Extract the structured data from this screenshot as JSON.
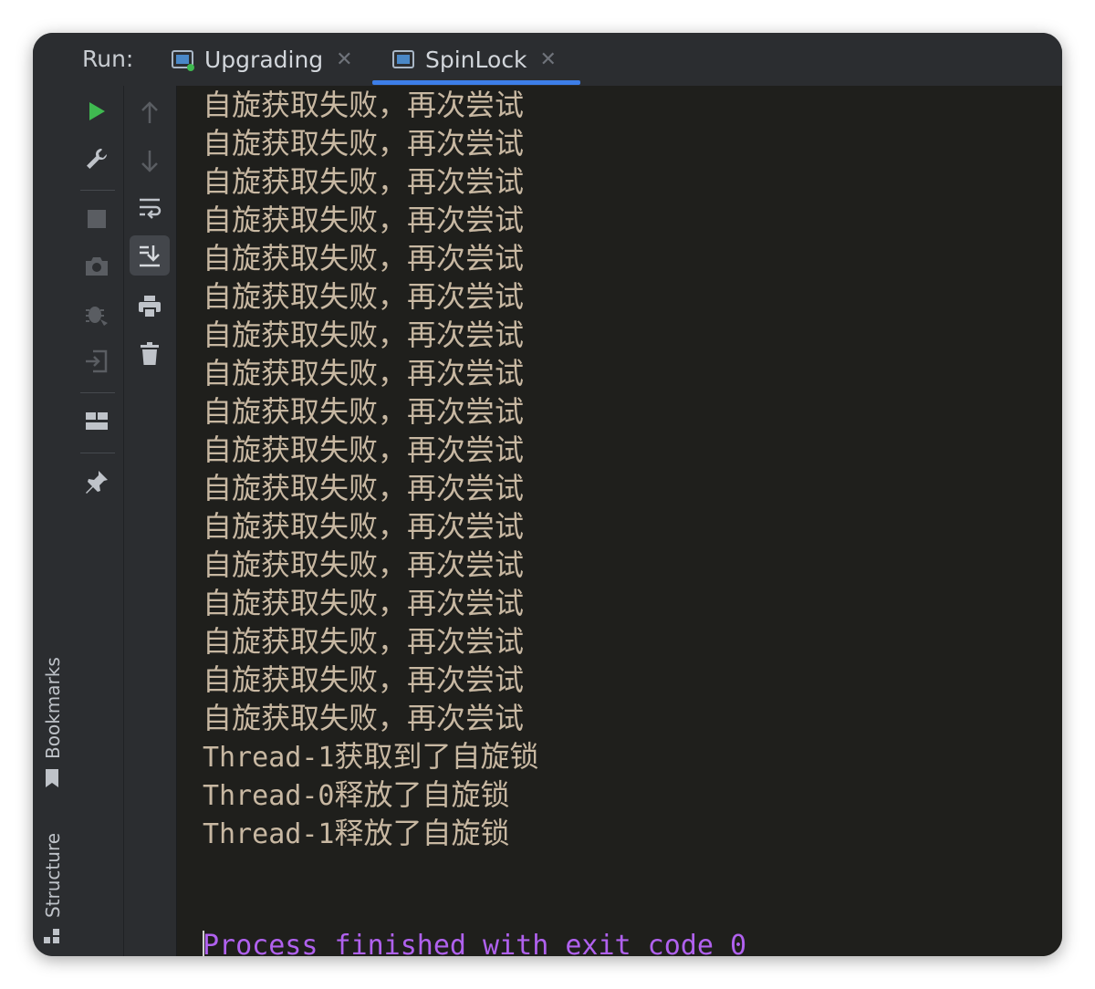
{
  "run_label": "Run:",
  "tabs": [
    {
      "label": "Upgrading",
      "active": false
    },
    {
      "label": "SpinLock",
      "active": true
    }
  ],
  "side_panels": {
    "bookmarks": "Bookmarks",
    "structure": "Structure"
  },
  "console": {
    "retry_lines": [
      "自旋获取失败，再次尝试",
      "自旋获取失败，再次尝试",
      "自旋获取失败，再次尝试",
      "自旋获取失败，再次尝试",
      "自旋获取失败，再次尝试",
      "自旋获取失败，再次尝试",
      "自旋获取失败，再次尝试",
      "自旋获取失败，再次尝试",
      "自旋获取失败，再次尝试",
      "自旋获取失败，再次尝试",
      "自旋获取失败，再次尝试",
      "自旋获取失败，再次尝试",
      "自旋获取失败，再次尝试",
      "自旋获取失败，再次尝试",
      "自旋获取失败，再次尝试",
      "自旋获取失败，再次尝试",
      "自旋获取失败，再次尝试"
    ],
    "thread_lines": [
      {
        "thread": "Thread-1",
        "message": "获取到了自旋锁"
      },
      {
        "thread": "Thread-0",
        "message": "释放了自旋锁"
      },
      {
        "thread": "Thread-1",
        "message": "释放了自旋锁"
      }
    ],
    "exit_message": "Process finished with exit code 0"
  },
  "colors": {
    "output_text": "#c8b8a2",
    "exit_text": "#b061ee",
    "run_green": "#3fb950",
    "accent": "#3d7ee8"
  }
}
